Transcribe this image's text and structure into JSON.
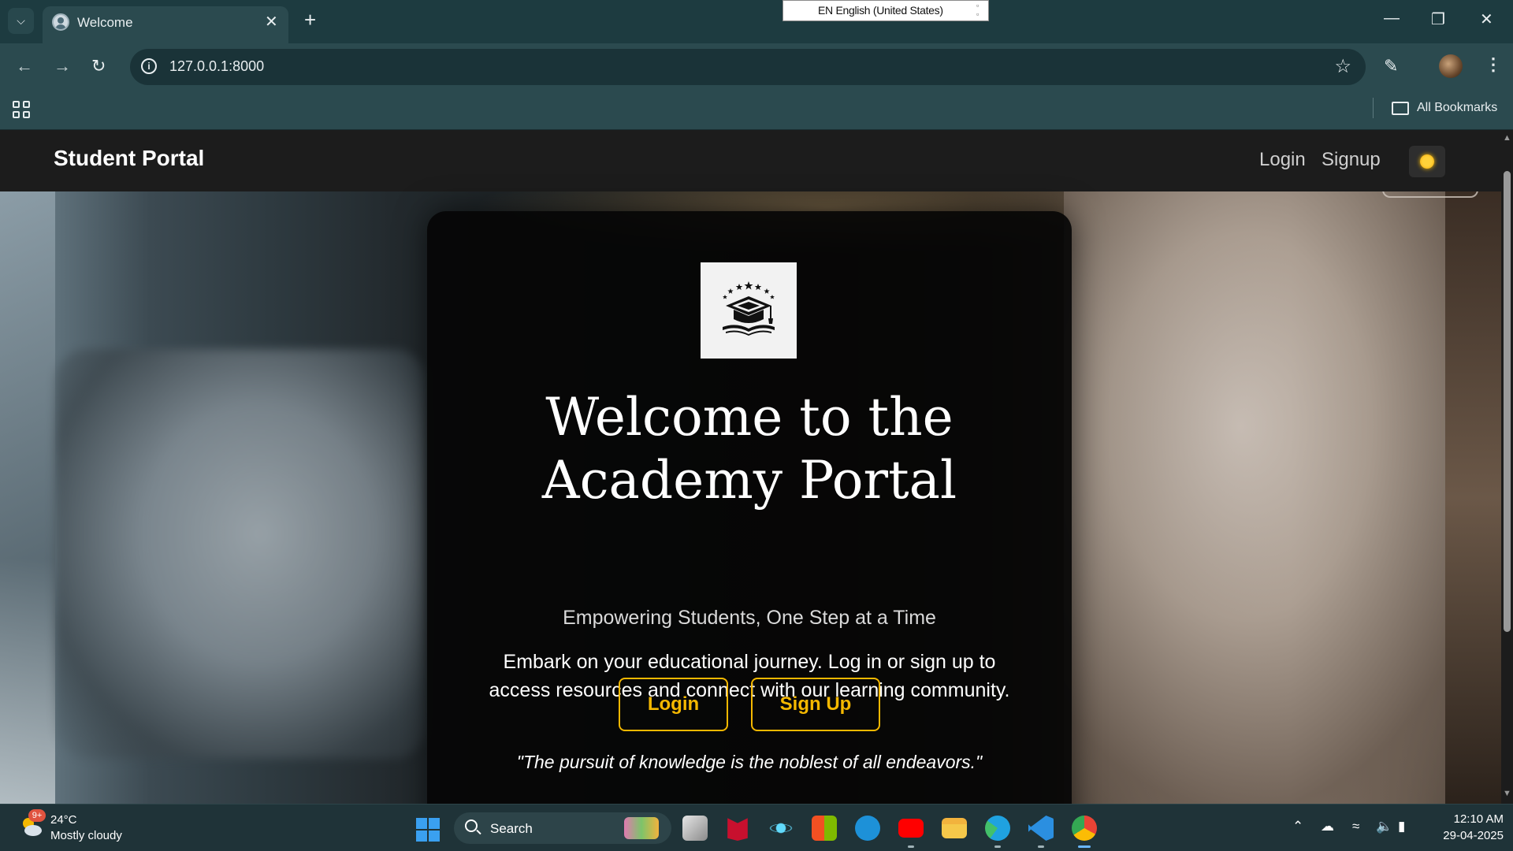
{
  "browser": {
    "tab_title": "Welcome",
    "url": "127.0.0.1:8000",
    "bookmarks_label": "All Bookmarks",
    "language_indicator": "EN English (United States)"
  },
  "navbar": {
    "brand": "Student Portal",
    "login_label": "Login",
    "signup_label": "Signup"
  },
  "hero": {
    "title_line1": "Welcome to the",
    "title_line2": "Academy Portal",
    "tagline": "Empowering Students, One Step at a Time",
    "description": "Embark on your educational journey. Log in or sign up to access resources and connect with our learning community.",
    "login_button": "Login",
    "signup_button": "Sign Up",
    "quote": "\"The pursuit of knowledge is the noblest of all endeavors.\""
  },
  "colors": {
    "accent": "#f5b800",
    "navbar_bg": "#1c1c1c",
    "card_bg": "#050505",
    "chrome_bg": "#2b4a4f"
  },
  "icons": {
    "logo": "graduation-cap-with-stars-icon",
    "theme_toggle": "sun-icon"
  },
  "taskbar": {
    "weather_temp": "24°C",
    "weather_desc": "Mostly cloudy",
    "weather_badge": "9+",
    "search_label": "Search",
    "time": "12:10 AM",
    "date": "29-04-2025"
  }
}
